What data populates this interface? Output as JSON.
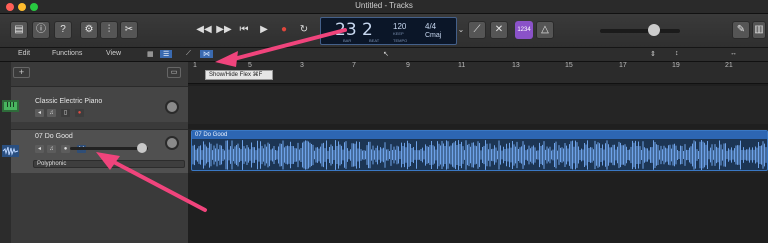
{
  "window": {
    "title": "Untitled - Tracks"
  },
  "lcd": {
    "position": "23 2",
    "bar_label": "BAR",
    "beat_label": "BEAT",
    "tempo": "120",
    "tempo_mode": "KEEP",
    "tempo_label": "TEMPO",
    "time_signature": "4/4",
    "key": "Cmaj"
  },
  "tuner_label": "1234",
  "menus": [
    "Edit",
    "Functions",
    "View"
  ],
  "tooltip": {
    "text": "Show/Hide Flex  ⌘F"
  },
  "tracks": [
    {
      "name": "Classic Electric Piano",
      "type": "software-instrument"
    },
    {
      "name": "07 Do Good",
      "type": "audio",
      "flex_mode": "Polyphonic"
    }
  ],
  "region": {
    "name": "07 Do Good"
  },
  "ruler_ticks": [
    "1",
    "3",
    "5",
    "7",
    "9",
    "11",
    "13",
    "15",
    "17",
    "19",
    "21"
  ],
  "colors": {
    "accent": "#2d66b3",
    "arrow": "#f0447c",
    "tuner": "#8a52c8"
  }
}
